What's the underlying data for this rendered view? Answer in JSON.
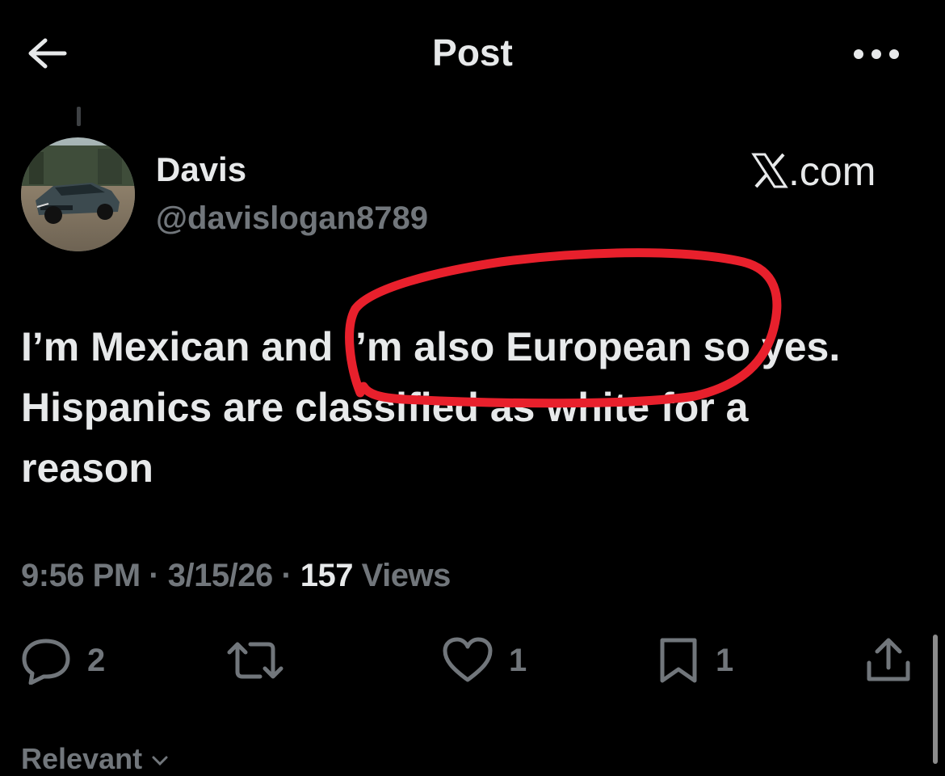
{
  "header": {
    "title": "Post",
    "back_icon": "arrow-left-icon",
    "more_icon": "more-horizontal-icon"
  },
  "post": {
    "author_name": "Davis",
    "author_handle": "@davislogan8789",
    "watermark": ".com",
    "text": "I’m Mexican and I’m also European so yes.\nHispanics are classified as white for a\nreason",
    "time": "9:56 PM",
    "date": "3/15/26",
    "views_count": "157",
    "views_label": "Views",
    "sep": "·"
  },
  "actions": {
    "reply_count": "2",
    "retweet_count": "",
    "like_count": "1",
    "bookmark_count": "1"
  },
  "replies_sort": {
    "label": "Relevant",
    "icon": "chevron-down-icon"
  },
  "colors": {
    "background": "#000000",
    "text_primary": "#e7e9ea",
    "text_secondary": "#71767b",
    "annotation": "#e8202c"
  }
}
